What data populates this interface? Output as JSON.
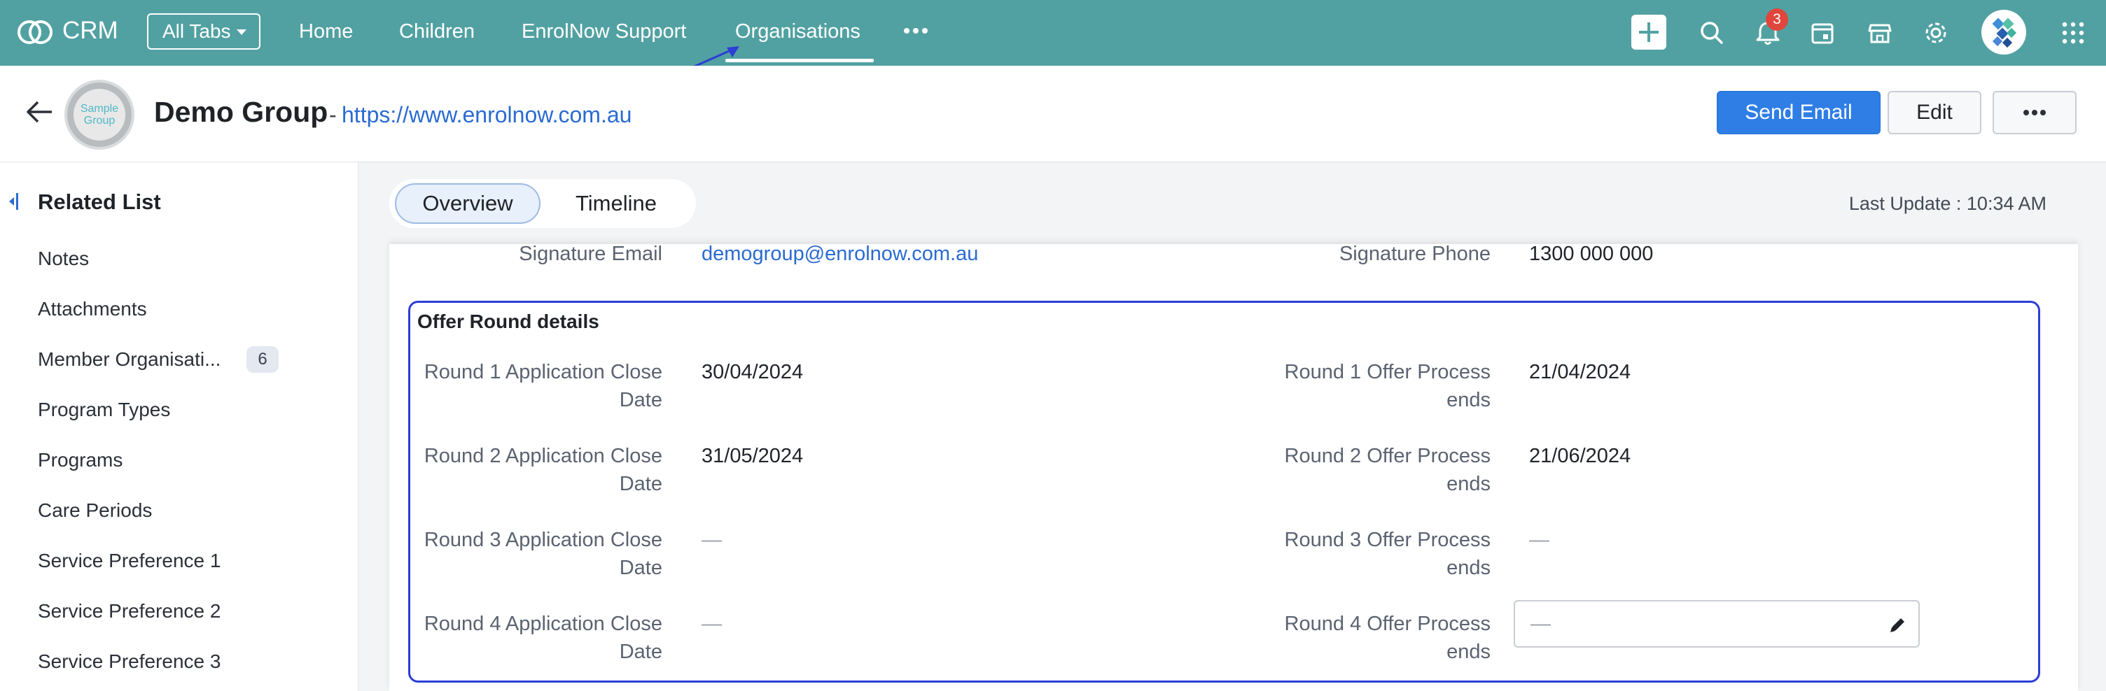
{
  "topbar": {
    "app_title": "CRM",
    "all_tabs_label": "All Tabs",
    "nav": [
      "Home",
      "Children",
      "EnrolNow Support",
      "Organisations"
    ],
    "active_nav": "Organisations",
    "notification_count": "3",
    "icons": [
      "crm-logo-icon",
      "more-dots-icon",
      "plus-icon",
      "search-icon",
      "bell-icon",
      "calendar-icon",
      "store-icon",
      "gear-icon",
      "profile-avatar",
      "apps-grid-icon"
    ]
  },
  "record": {
    "avatar_text": "Sample Group",
    "title": "Demo Group",
    "separator": "-",
    "website": "https://www.enrolnow.com.au",
    "buttons": {
      "send_email": "Send Email",
      "edit": "Edit"
    }
  },
  "sidebar": {
    "title": "Related List",
    "items": [
      {
        "label": "Notes"
      },
      {
        "label": "Attachments"
      },
      {
        "label": "Member Organisati...",
        "count": "6"
      },
      {
        "label": "Program Types"
      },
      {
        "label": "Programs"
      },
      {
        "label": "Care Periods"
      },
      {
        "label": "Service Preference 1"
      },
      {
        "label": "Service Preference 2"
      },
      {
        "label": "Service Preference 3"
      }
    ]
  },
  "tabs": {
    "overview": "Overview",
    "timeline": "Timeline",
    "active": "Overview"
  },
  "last_update": "Last Update : 10:34 AM",
  "signature": {
    "email_label": "Signature Email",
    "email_value": "demogroup@enrolnow.com.au",
    "phone_label": "Signature Phone",
    "phone_value": "1300 000 000"
  },
  "offer_round": {
    "title": "Offer Round details",
    "rows": [
      {
        "left_label_1": "Round 1 Application Close",
        "left_label_2": "Date",
        "left_value": "30/04/2024",
        "right_label_1": "Round 1 Offer Process",
        "right_label_2": "ends",
        "right_value": "21/04/2024"
      },
      {
        "left_label_1": "Round 2 Application Close",
        "left_label_2": "Date",
        "left_value": "31/05/2024",
        "right_label_1": "Round 2 Offer Process",
        "right_label_2": "ends",
        "right_value": "21/06/2024"
      },
      {
        "left_label_1": "Round 3 Application Close",
        "left_label_2": "Date",
        "left_value": "—",
        "right_label_1": "Round 3 Offer Process",
        "right_label_2": "ends",
        "right_value": "—"
      },
      {
        "left_label_1": "Round 4 Application Close",
        "left_label_2": "Date",
        "left_value": "—",
        "right_label_1": "Round 4 Offer Process",
        "right_label_2": "ends",
        "right_value": "—"
      }
    ]
  },
  "colors": {
    "topbar": "#52a1a2",
    "primary_button": "#2f7ee6",
    "annotation_box": "#2c3ed6",
    "badge": "#e0463c",
    "link": "#2a6bd1"
  }
}
